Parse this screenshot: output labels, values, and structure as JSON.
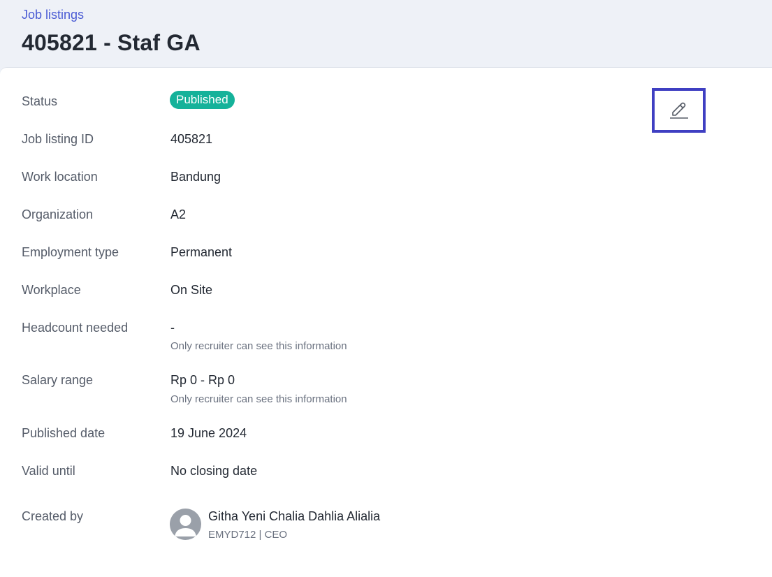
{
  "header": {
    "breadcrumb": "Job listings",
    "title": "405821 - Staf GA"
  },
  "details": {
    "status": {
      "label": "Status",
      "badge": "Published",
      "badge_color": "#15b29a"
    },
    "job_listing_id": {
      "label": "Job listing ID",
      "value": "405821"
    },
    "work_location": {
      "label": "Work location",
      "value": "Bandung"
    },
    "organization": {
      "label": "Organization",
      "value": "A2"
    },
    "employment_type": {
      "label": "Employment type",
      "value": "Permanent"
    },
    "workplace": {
      "label": "Workplace",
      "value": "On Site"
    },
    "headcount": {
      "label": "Headcount needed",
      "value": "-",
      "note": "Only recruiter can see this information"
    },
    "salary": {
      "label": "Salary range",
      "value": "Rp 0 - Rp 0",
      "note": "Only recruiter can see this information"
    },
    "published_date": {
      "label": "Published date",
      "value": "19 June 2024"
    },
    "valid_until": {
      "label": "Valid until",
      "value": "No closing date"
    },
    "created_by": {
      "label": "Created by",
      "name": "Githa Yeni Chalia Dahlia Alialia",
      "meta": "EMYD712 | CEO"
    }
  },
  "actions": {
    "edit_icon": "pencil-icon",
    "highlight_color": "#3f3fc2"
  }
}
